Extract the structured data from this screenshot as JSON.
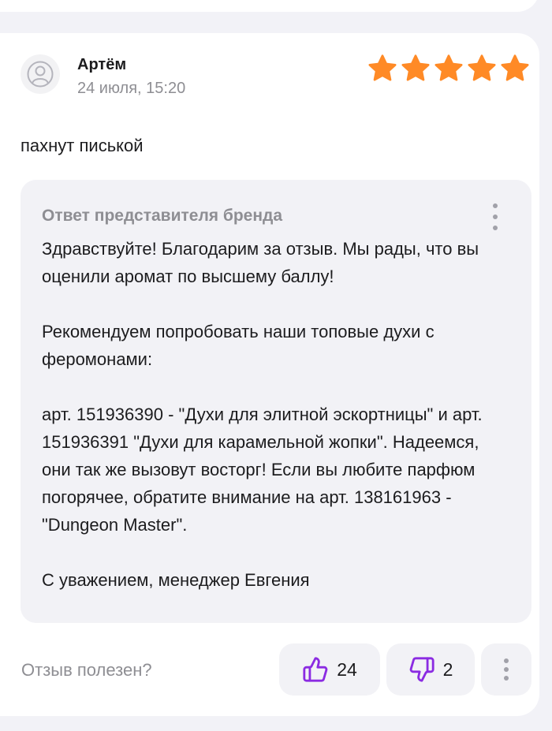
{
  "review": {
    "author": "Артём",
    "date": "24 июля, 15:20",
    "rating": 5,
    "star_color": "#ff8a26",
    "text": "пахнут писькой"
  },
  "reply": {
    "title": "Ответ представителя бренда",
    "paragraphs": [
      "Здравствуйте! Благодарим за отзыв. Мы рады, что вы оценили аромат по высшему баллу!",
      "Рекомендуем попробовать наши топовые духи с феромонами:",
      "арт. 151936390 - \"Духи для элитной эскортницы\" и арт. 151936391 \"Духи для карамельной жопки\". Надеемся, они так же вызовут восторг! Если вы любите парфюм погорячее, обратите внимание на арт. 138161963 - \"Dungeon Master\".",
      "С уважением, менеджер Евгения"
    ]
  },
  "footer": {
    "helpful_question": "Отзыв полезен?",
    "likes": "24",
    "dislikes": "2",
    "accent_color": "#8b2be2"
  },
  "icons": {
    "avatar": "user-icon",
    "like": "thumbs-up-icon",
    "dislike": "thumbs-down-icon",
    "menu": "more-vertical-icon",
    "star": "star-icon"
  }
}
